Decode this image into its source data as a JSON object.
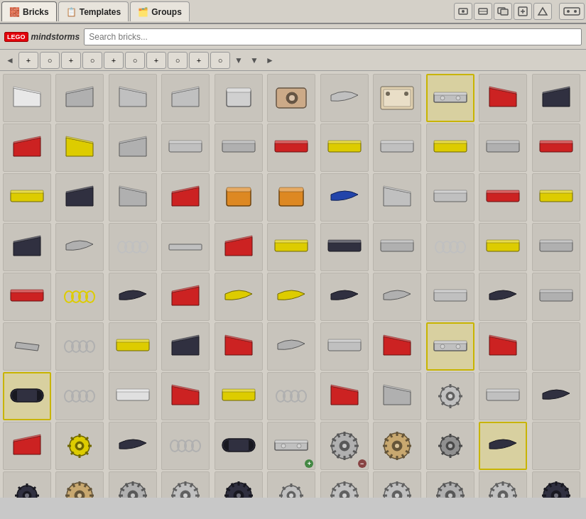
{
  "tabs": [
    {
      "id": "bricks",
      "label": "Bricks",
      "active": false,
      "icon": "🧱"
    },
    {
      "id": "templates",
      "label": "Templates",
      "active": true,
      "icon": "📋"
    },
    {
      "id": "groups",
      "label": "Groups",
      "active": false,
      "icon": "🗂️"
    }
  ],
  "toolbar": {
    "buttons_left": [
      "⊞",
      "⊡",
      "⊟",
      "⊞",
      "⊡",
      "⊟",
      "⊞",
      "⊡"
    ],
    "buttons_right": [
      "↩",
      "↪"
    ],
    "arrow_down": "▼"
  },
  "search": {
    "logo_text": "LEGO",
    "brand": "mindstorms",
    "placeholder": "Search bricks..."
  },
  "filter_bar": {
    "arrows_left": "◄",
    "arrows_right": "►",
    "buttons": [
      "+",
      "○",
      "+",
      "○",
      "+",
      "○",
      "+",
      "○",
      "+",
      "○",
      "▼",
      "▼"
    ]
  },
  "grid": {
    "total_cells": 121,
    "selected_cells": [
      11,
      55,
      77,
      88,
      99
    ],
    "badge_plus_cells": [
      33,
      66
    ],
    "badge_minus_cells": [
      11,
      55
    ]
  },
  "colors": {
    "white": "#f0f0f0",
    "light_gray": "#b0b0b0",
    "dark_gray": "#404040",
    "red": "#cc2222",
    "yellow": "#ddcc00",
    "blue": "#2244aa",
    "orange": "#dd8822",
    "black": "#222222",
    "tan": "#c8a870",
    "dark_tan": "#a08060",
    "dark_blue": "#223366",
    "accent_yellow": "#c8b400",
    "bg": "#d4d0c8"
  }
}
